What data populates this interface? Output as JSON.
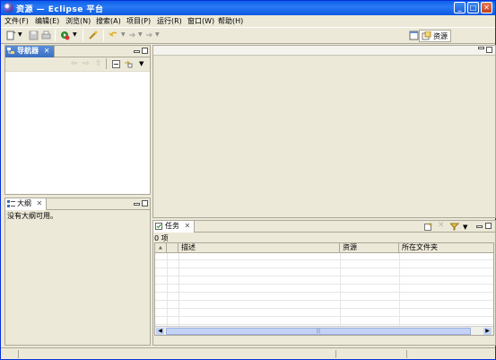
{
  "window": {
    "title": "资源 — Eclipse 平台",
    "minimize_label": "_",
    "maximize_label": "□",
    "close_label": "✕"
  },
  "menubar": {
    "items": [
      "文件(F)",
      "编辑(E)",
      "浏览(N)",
      "搜索(A)",
      "项目(P)",
      "运行(R)",
      "窗口(W)",
      "帮助(H)"
    ]
  },
  "toolbar": {
    "icons": [
      "new-icon",
      "save-icon",
      "print-icon",
      "run-icon",
      "open-perspective-task-icon",
      "back-icon",
      "forward-icon"
    ],
    "perspective_label": "资源"
  },
  "navigator": {
    "tab_label": "导航器",
    "close_glyph": "✕",
    "toolbar_icons": [
      "back-icon",
      "forward-icon",
      "up-icon",
      "collapse-all-icon",
      "link-with-editor-icon",
      "view-menu-icon"
    ]
  },
  "outline": {
    "tab_label": "大纲",
    "close_glyph": "✕",
    "message": "没有大纲可用。"
  },
  "tasks": {
    "tab_label": "任务",
    "close_glyph": "✕",
    "count_text": "0 项",
    "columns": [
      "",
      "",
      "描述",
      "资源",
      "所在文件夹"
    ],
    "toolbar_icons": [
      "add-task-icon",
      "delete-icon",
      "filter-icon",
      "view-menu-icon"
    ],
    "scroll_glyph": "|||"
  },
  "colors": {
    "titlebar": "#0a5ee9",
    "active_tab": "#3b6fc2",
    "chrome": "#ece9d8"
  }
}
